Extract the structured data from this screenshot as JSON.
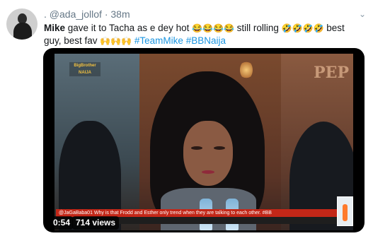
{
  "tweet": {
    "handle": "@ada_jollof",
    "time": "38m",
    "author_mention": "Mike",
    "text_part1": " gave it to Tacha as e dey hot ",
    "emojis1": "😂😂😂😂",
    "text_part2": " still rolling ",
    "emojis2": "🤣🤣🤣🤣",
    "text_part3": " best guy, best fav ",
    "emojis3": "🙌🙌🙌",
    "hashtags": [
      "#TeamMike",
      "#BBNaija"
    ]
  },
  "media": {
    "duration": "0:54",
    "views": "714 views",
    "ticker_text": "@JaGaBaba01 Why is that Frodd and Esther only trend when they are talking to each other. #BB",
    "logo_text": "BigBrother NAIJA",
    "watermark": "PEP"
  },
  "icons": {
    "menu": "chevron-down-icon",
    "verified_bar": "dot-icon"
  }
}
